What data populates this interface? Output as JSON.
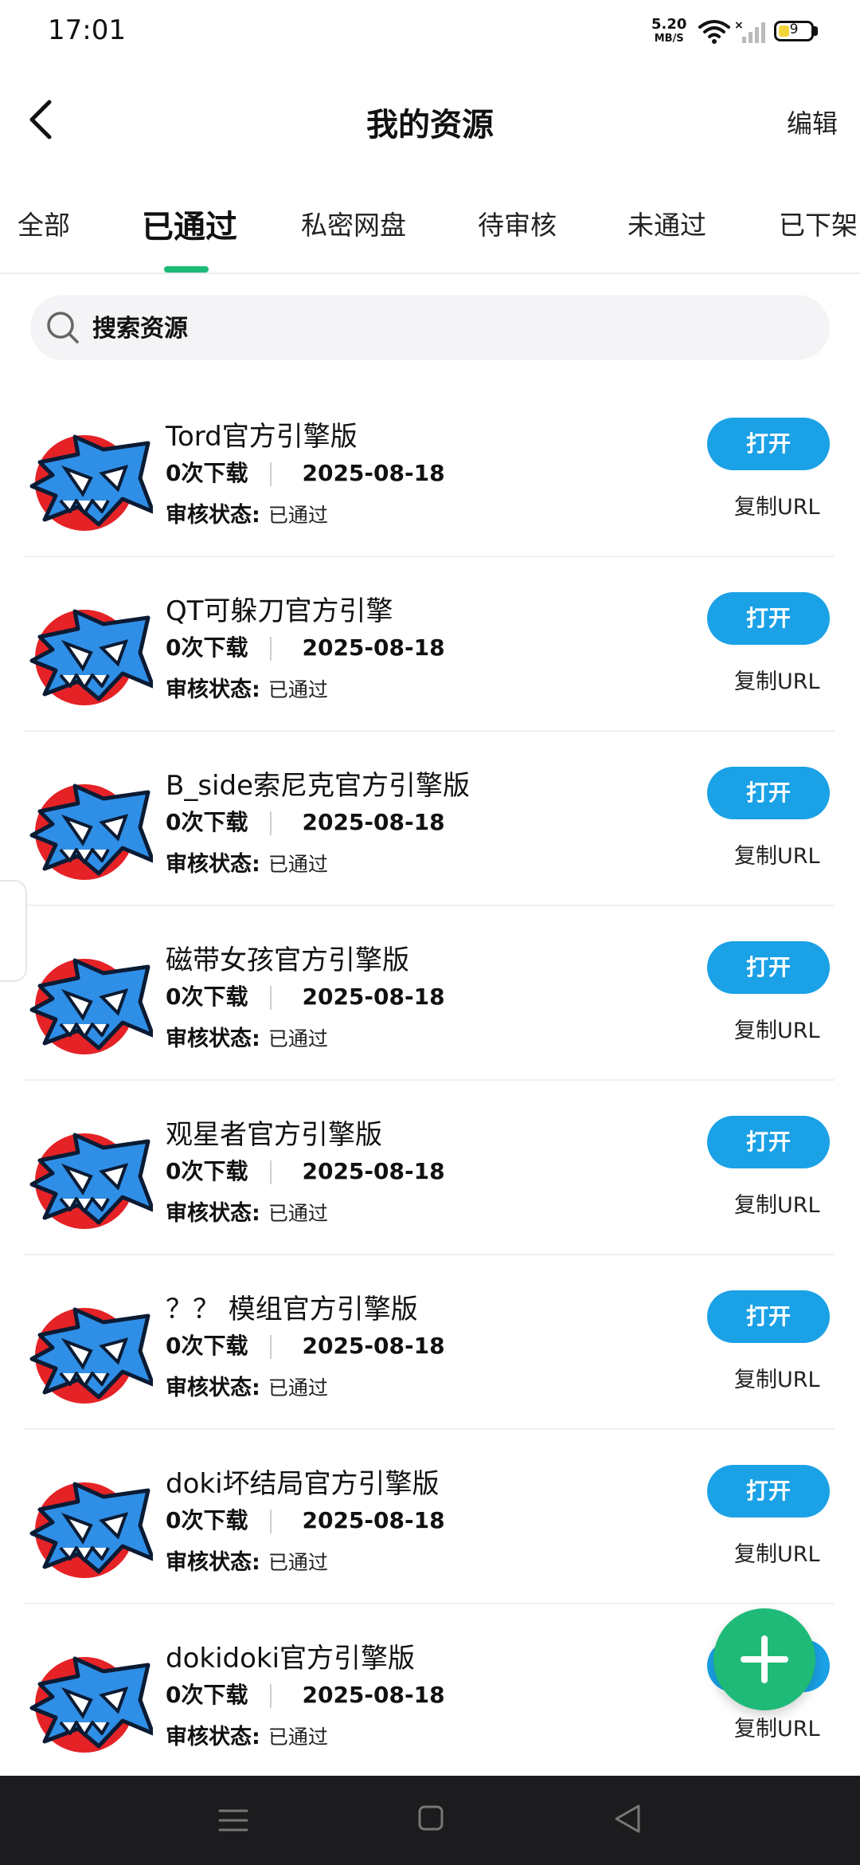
{
  "status": {
    "time": "17:01",
    "speed_value": "5.20",
    "speed_unit": "MB/S",
    "battery": "9"
  },
  "header": {
    "title": "我的资源",
    "edit_label": "编辑"
  },
  "tabs": [
    "全部",
    "已通过",
    "私密网盘",
    "待审核",
    "未通过",
    "已下架"
  ],
  "active_tab": "已通过",
  "search": {
    "placeholder": "搜索资源"
  },
  "list": {
    "open_label": "打开",
    "copy_label": "复制URL",
    "status_label": "审核状态:",
    "items": [
      {
        "title": "Tord官方引擎版",
        "downloads": "0次下载",
        "date": "2025-08-18",
        "status": "已通过"
      },
      {
        "title": "QT可躲刀官方引擎",
        "downloads": "0次下载",
        "date": "2025-08-18",
        "status": "已通过"
      },
      {
        "title": "B_side索尼克官方引擎版",
        "downloads": "0次下载",
        "date": "2025-08-18",
        "status": "已通过"
      },
      {
        "title": "磁带女孩官方引擎版",
        "downloads": "0次下载",
        "date": "2025-08-18",
        "status": "已通过"
      },
      {
        "title": "观星者官方引擎版",
        "downloads": "0次下载",
        "date": "2025-08-18",
        "status": "已通过"
      },
      {
        "title": "？？ 模组官方引擎版",
        "downloads": "0次下载",
        "date": "2025-08-18",
        "status": "已通过"
      },
      {
        "title": "doki坏结局官方引擎版",
        "downloads": "0次下载",
        "date": "2025-08-18",
        "status": "已通过"
      },
      {
        "title": "dokidoki官方引擎版",
        "downloads": "0次下载",
        "date": "2025-08-18",
        "status": "已通过"
      }
    ]
  },
  "colors": {
    "accent_green": "#1fba78",
    "button_blue": "#1aa1e6",
    "navbar": "#1c1c1e"
  },
  "icons": {
    "fab": "plus-icon",
    "back": "back-arrow-icon",
    "search": "search-icon"
  }
}
